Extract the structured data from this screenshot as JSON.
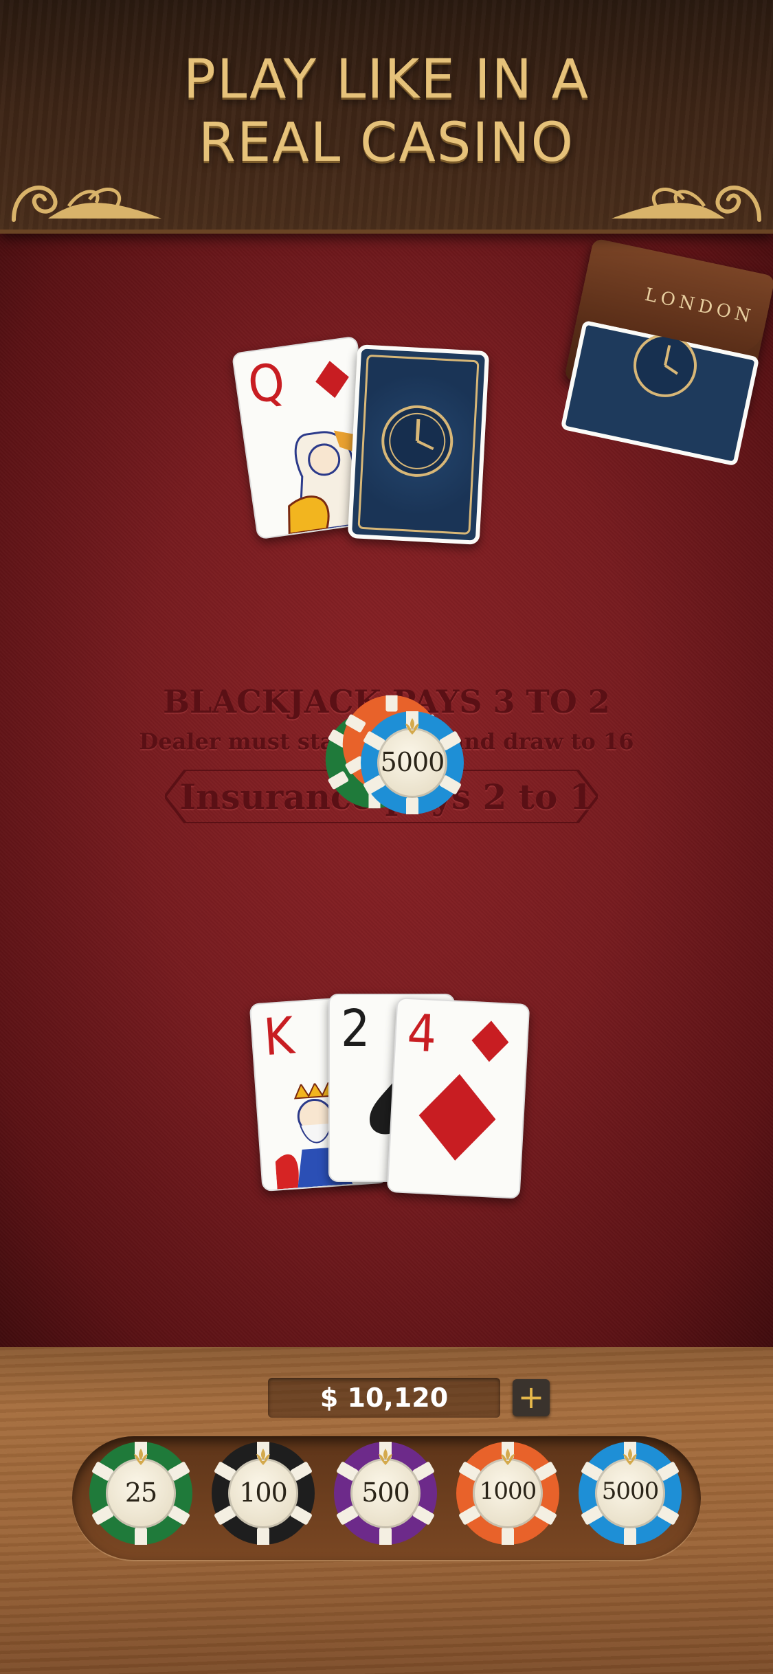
{
  "header": {
    "title_line1": "PLAY LIKE IN A",
    "title_line2": "REAL CASINO"
  },
  "shoe": {
    "label": "LONDON"
  },
  "table": {
    "rule_blackjack": "BLACKJACK PAYS 3 TO 2",
    "rule_dealer": "Dealer must stand on 17 and draw to 16",
    "rule_insurance": "Insurance pays 2 to 1"
  },
  "dealer_hand": {
    "cards": [
      {
        "rank": "Q",
        "suit": "diamond"
      },
      {
        "rank": "",
        "suit": "face-down"
      }
    ]
  },
  "bet": {
    "chip_value": "5000"
  },
  "player_hand": {
    "cards": [
      {
        "rank": "K",
        "suit": "heart"
      },
      {
        "rank": "2",
        "suit": "spade"
      },
      {
        "rank": "4",
        "suit": "diamond"
      }
    ]
  },
  "balance": {
    "amount": "$ 10,120",
    "add_label": "+"
  },
  "chips": [
    {
      "value": "25",
      "color": "#1f7a3a"
    },
    {
      "value": "100",
      "color": "#1e1e1e"
    },
    {
      "value": "500",
      "color": "#6d2a8a"
    },
    {
      "value": "1000",
      "color": "#e8622a"
    },
    {
      "value": "5000",
      "color": "#1e8fd6"
    }
  ],
  "colors": {
    "gold": "#e6c27a",
    "felt": "#7a1c20",
    "wood": "#9b6437"
  }
}
